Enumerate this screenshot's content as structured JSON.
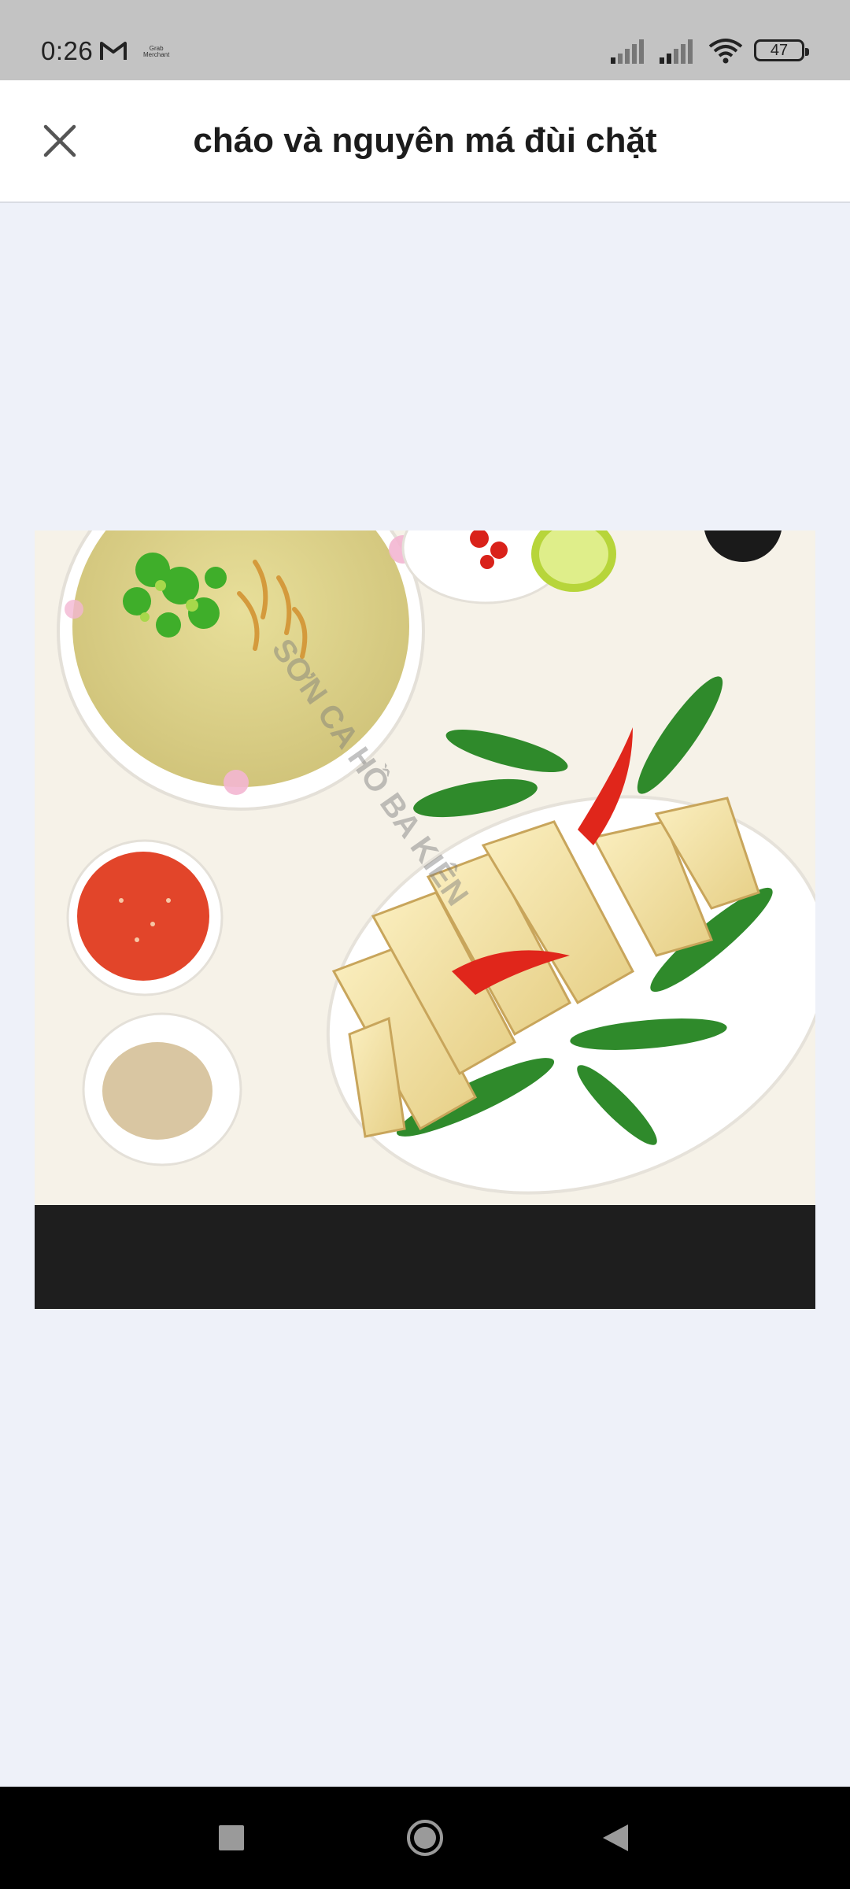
{
  "status_bar": {
    "time": "0:26",
    "notification_icons": [
      "gmail-icon",
      "grab-merchant-icon"
    ],
    "grab_label_line1": "Grab",
    "grab_label_line2": "Merchant",
    "battery_level": "47"
  },
  "header": {
    "title": "cháo và nguyên má đùi chặt",
    "close_icon": "close-icon"
  },
  "image": {
    "watermark": "SƠN CA HỒ BA KIÊN",
    "logo_text": "HỒ BA KIÊN"
  },
  "nav_bar": {
    "buttons": [
      "recents-button",
      "home-button",
      "back-button"
    ]
  },
  "colors": {
    "status_bar_bg": "#c3c3c3",
    "page_bg": "#eef1f9",
    "header_bg": "#ffffff",
    "nav_bg": "#000000"
  }
}
